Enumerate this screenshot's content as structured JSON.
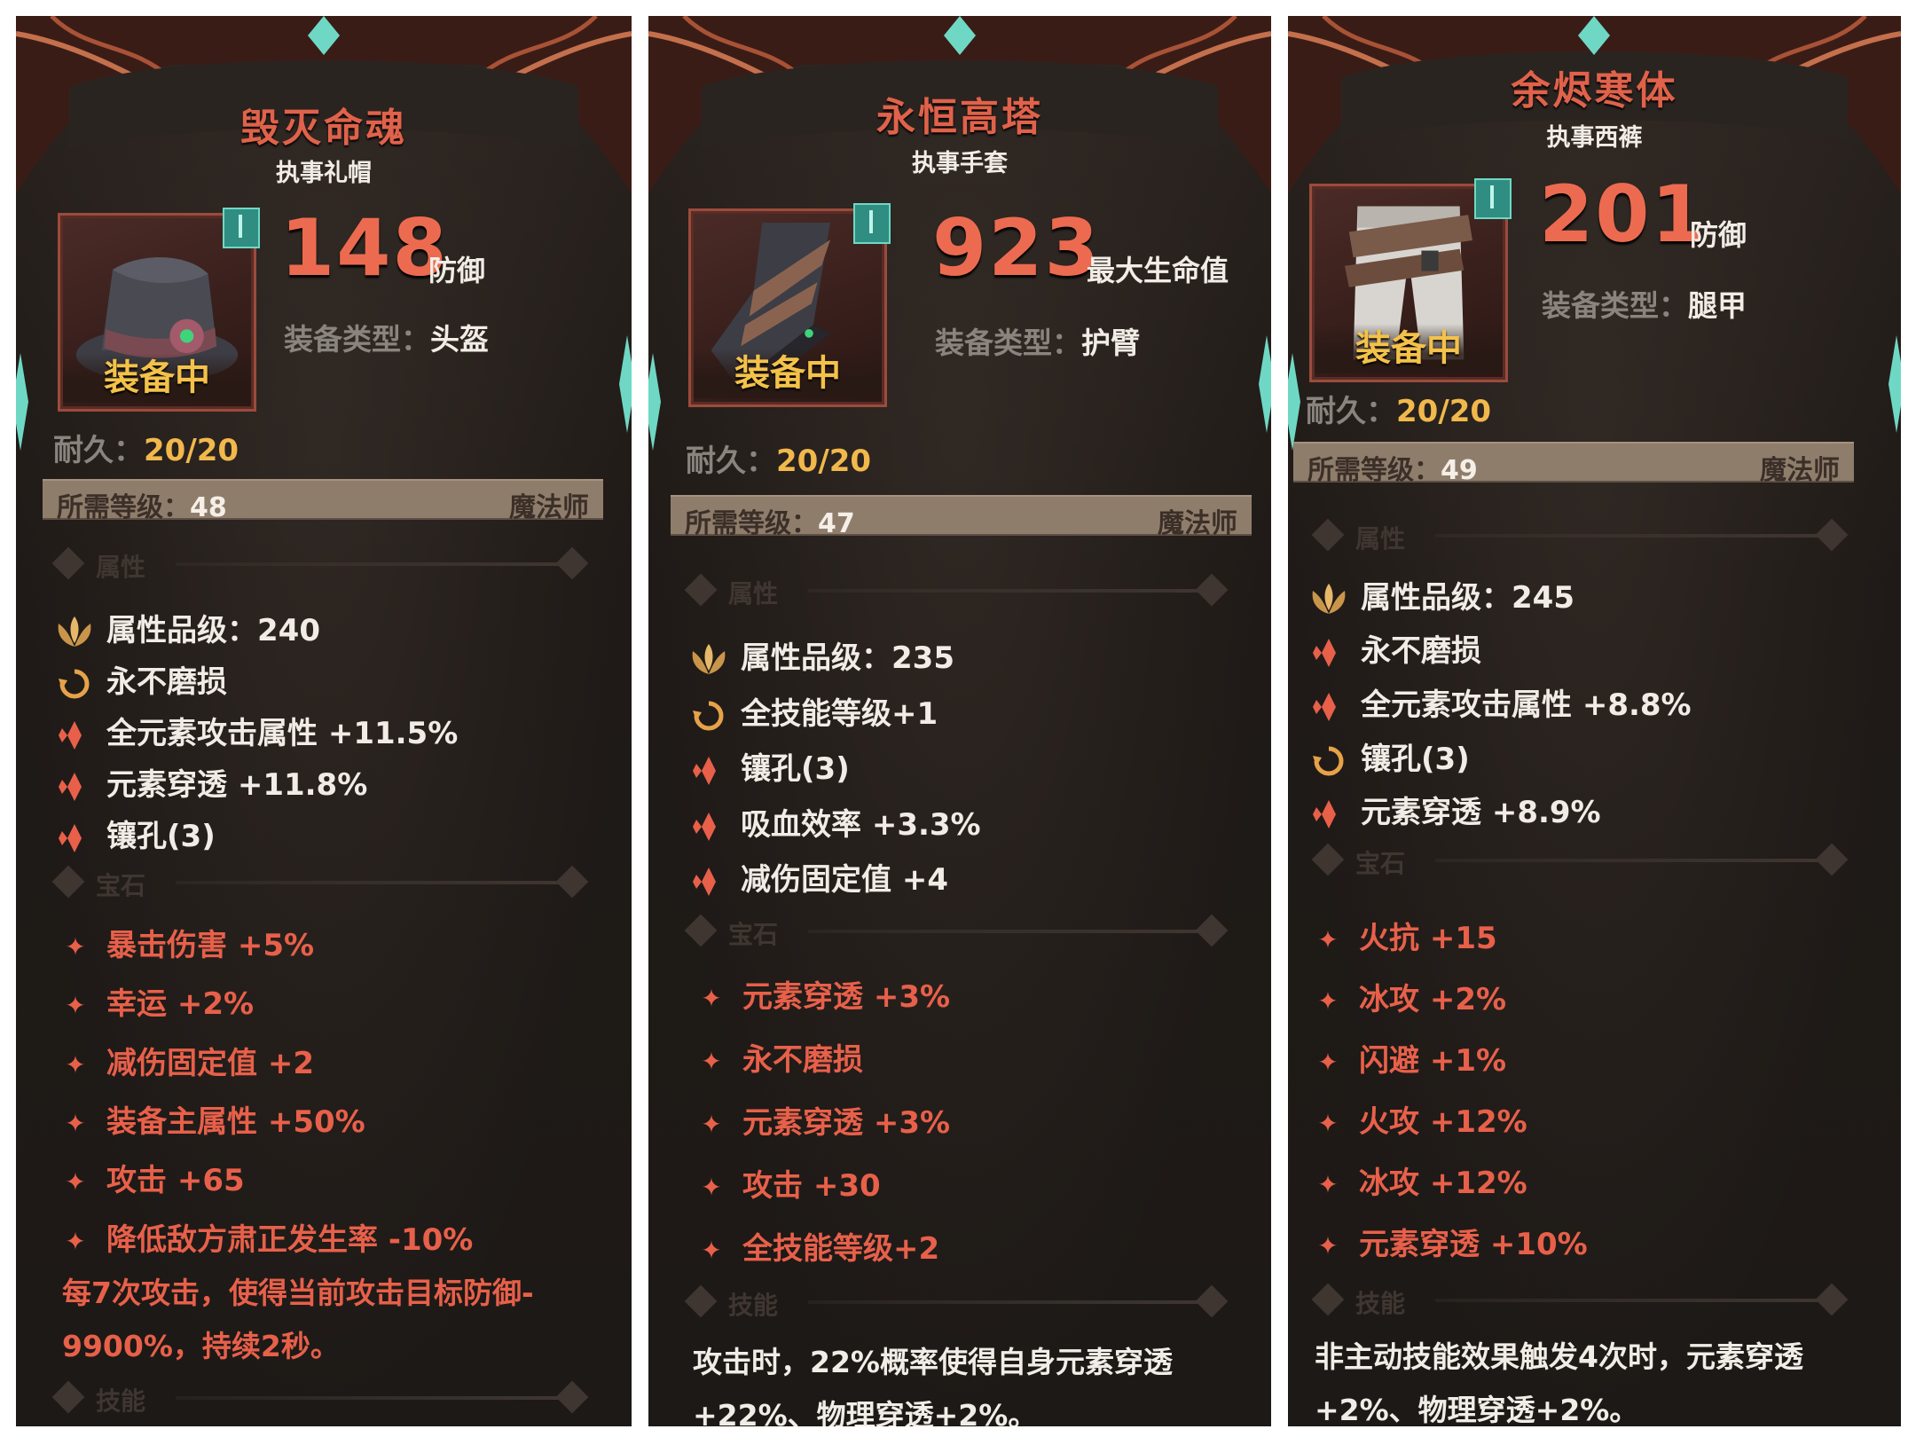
{
  "colors": {
    "name": "#e0624a",
    "gem": "#e8604a",
    "equipped": "#f4c24a",
    "durability": "#f1b84c",
    "accent": "#6fd8c4"
  },
  "labels": {
    "equipped": "装备中",
    "durability_prefix": "耐久：",
    "type_prefix": "装备类型：",
    "level_prefix": "所需等级：",
    "section_attr": "属性",
    "section_gem": "宝石",
    "section_skill": "技能"
  },
  "cards": [
    {
      "name": "毁灭命魂",
      "subtitle": "执事礼帽",
      "icon": "hat-icon",
      "stat_value": "148",
      "stat_label": "防御",
      "type": "头盔",
      "durability": "20/20",
      "level": "48",
      "class": "魔法师",
      "attributes": [
        {
          "icon": "lotus-icon",
          "text": "属性品级：240"
        },
        {
          "icon": "cycle-icon",
          "text": "永不磨损"
        },
        {
          "icon": "spark-icon",
          "text": "全元素攻击属性 +11.5%"
        },
        {
          "icon": "spark-icon",
          "text": "元素穿透 +11.8%"
        },
        {
          "icon": "spark-icon",
          "text": "镶孔(3)"
        }
      ],
      "gems": [
        "暴击伤害 +5%",
        "幸运 +2%",
        "减伤固定值 +2",
        "装备主属性 +50%",
        "攻击 +65",
        "降低敌方肃正发生率 -10%"
      ],
      "desc_lines": [
        "每7次攻击，使得当前攻击目标防御-",
        "9900%，持续2秒。"
      ]
    },
    {
      "name": "永恒高塔",
      "subtitle": "执事手套",
      "icon": "gauntlet-icon",
      "stat_value": "923",
      "stat_label": "最大生命值",
      "type": "护臂",
      "durability": "20/20",
      "level": "47",
      "class": "魔法师",
      "attributes": [
        {
          "icon": "lotus-icon",
          "text": "属性品级：235"
        },
        {
          "icon": "cycle-icon",
          "text": "全技能等级+1"
        },
        {
          "icon": "spark-icon",
          "text": "镶孔(3)"
        },
        {
          "icon": "spark-icon",
          "text": "吸血效率 +3.3%"
        },
        {
          "icon": "spark-icon",
          "text": "减伤固定值 +4"
        }
      ],
      "gems": [
        "元素穿透 +3%",
        "永不磨损",
        "元素穿透 +3%",
        "攻击 +30",
        "全技能等级+2"
      ],
      "desc_lines": [
        "攻击时，22%概率使得自身元素穿透",
        "+22%、物理穿透+2%。"
      ]
    },
    {
      "name": "余烬寒体",
      "subtitle": "执事西裤",
      "icon": "trousers-icon",
      "stat_value": "201",
      "stat_label": "防御",
      "type": "腿甲",
      "durability": "20/20",
      "level": "49",
      "class": "魔法师",
      "attributes": [
        {
          "icon": "lotus-icon",
          "text": "属性品级：245"
        },
        {
          "icon": "spark-icon",
          "text": "永不磨损"
        },
        {
          "icon": "spark-icon",
          "text": "全元素攻击属性 +8.8%"
        },
        {
          "icon": "cycle-icon",
          "text": "镶孔(3)"
        },
        {
          "icon": "spark-icon",
          "text": "元素穿透 +8.9%"
        }
      ],
      "gems": [
        "火抗 +15",
        "冰攻 +2%",
        "闪避 +1%",
        "火攻 +12%",
        "冰攻 +12%",
        "元素穿透 +10%"
      ],
      "desc_lines": [
        "非主动技能效果触发4次时，元素穿透",
        "+2%、物理穿透+2%。"
      ]
    }
  ]
}
